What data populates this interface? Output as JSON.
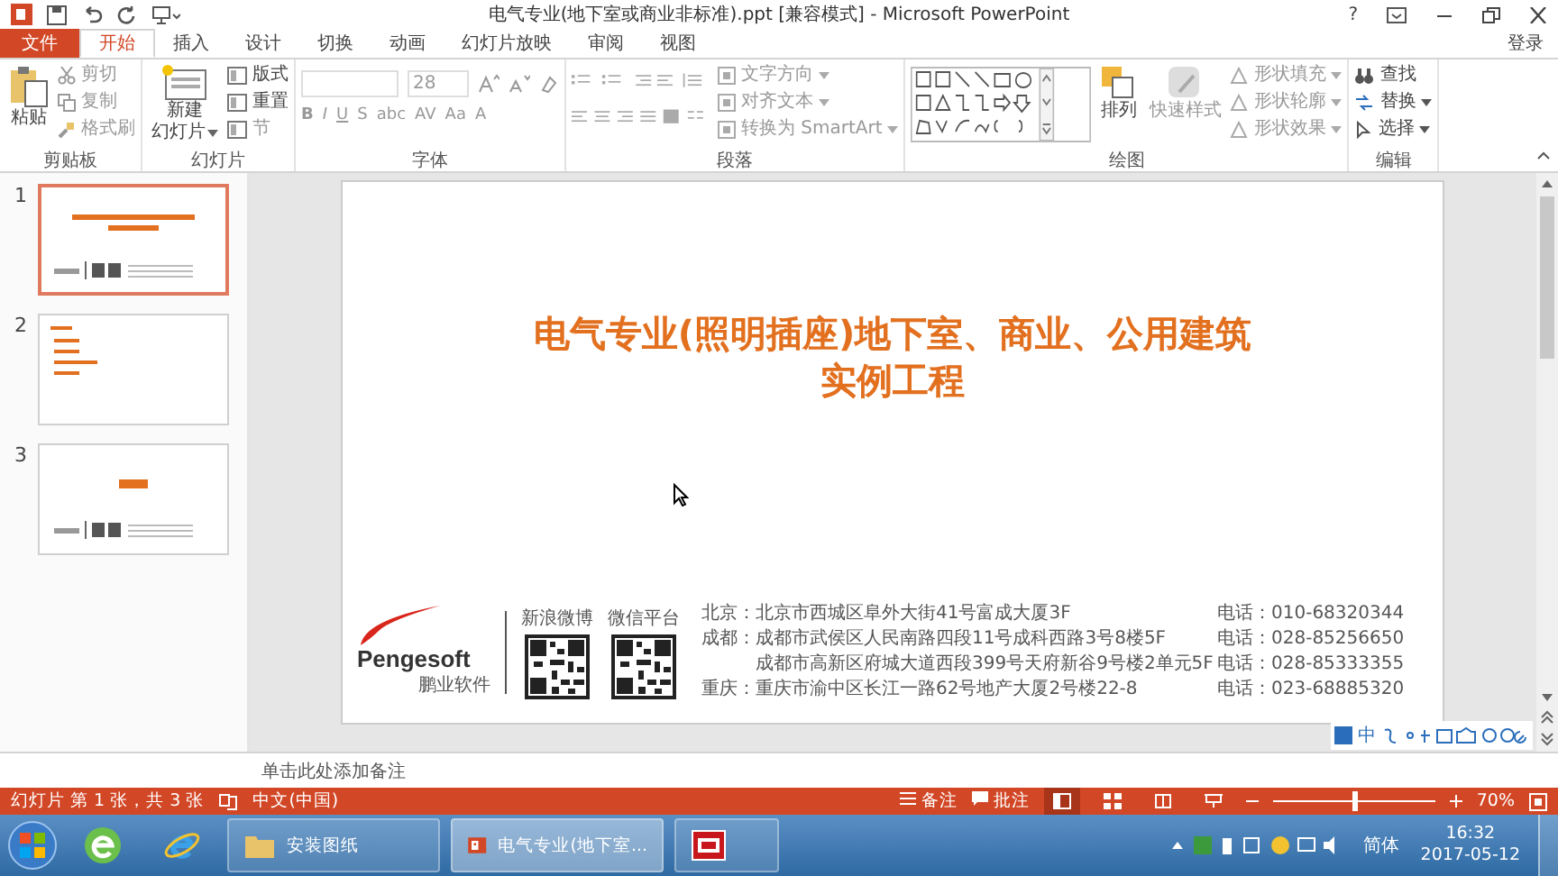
{
  "window": {
    "title": "电气专业(地下室或商业非标准).ppt [兼容模式] - Microsoft PowerPoint",
    "help": "?",
    "sign_in": "登录"
  },
  "ribbon_tabs": [
    {
      "label": "文件",
      "kind": "file",
      "selected": false
    },
    {
      "label": "开始",
      "kind": "tab",
      "selected": true
    },
    {
      "label": "插入",
      "kind": "tab",
      "selected": false
    },
    {
      "label": "设计",
      "kind": "tab",
      "selected": false
    },
    {
      "label": "切换",
      "kind": "tab",
      "selected": false
    },
    {
      "label": "动画",
      "kind": "tab",
      "selected": false
    },
    {
      "label": "幻灯片放映",
      "kind": "tab",
      "selected": false
    },
    {
      "label": "审阅",
      "kind": "tab",
      "selected": false
    },
    {
      "label": "视图",
      "kind": "tab",
      "selected": false
    }
  ],
  "clipboard": {
    "label": "剪贴板",
    "paste": "粘贴",
    "items": [
      "剪切",
      "复制",
      "格式刷"
    ]
  },
  "slides_group": {
    "label": "幻灯片",
    "new_slide": [
      "新建",
      "幻灯片"
    ],
    "items": [
      "版式",
      "重置",
      "节"
    ]
  },
  "font": {
    "label": "字体",
    "size": "28",
    "buttons": [
      "B",
      "I",
      "U",
      "S",
      "abc",
      "AV",
      "Aa",
      "A"
    ]
  },
  "paragraph": {
    "label": "段落",
    "items": [
      "文字方向",
      "对齐文本",
      "转换为 SmartArt"
    ]
  },
  "drawing": {
    "label": "绘图",
    "arrange": "排列",
    "quick_styles": "快速样式",
    "items": [
      "形状填充",
      "形状轮廓",
      "形状效果"
    ]
  },
  "editing": {
    "label": "编辑",
    "items": [
      "查找",
      "替换",
      "选择"
    ]
  },
  "thumbnails": [
    {
      "number": "1",
      "kind": "title",
      "selected": true
    },
    {
      "number": "2",
      "kind": "list",
      "selected": false
    },
    {
      "number": "3",
      "kind": "closing",
      "selected": false
    }
  ],
  "slide": {
    "title_lines": [
      "电气专业(照明插座)地下室、商业、公用建筑",
      "实例工程"
    ],
    "logo": {
      "name": "Pengesoft",
      "chinese": "鹏业软件"
    },
    "qr_codes": [
      {
        "label": "新浪微博"
      },
      {
        "label": "微信平台"
      }
    ],
    "offices": [
      {
        "city": "北京：",
        "address": "北京市西城区阜外大街41号富成大厦3F",
        "phone": "电话：010-68320344"
      },
      {
        "city": "成都：",
        "address": "成都市武侯区人民南路四段11号成科西路3号8楼5F",
        "phone": "电话：028-85256650"
      },
      {
        "address": "成都市高新区府城大道西段399号天府新谷9号楼2单元5F",
        "phone": "电话：028-85333355"
      },
      {
        "city": "重庆：",
        "address": "重庆市渝中区长江一路62号地产大厦2号楼22-8",
        "phone": "电话：023-68885320"
      }
    ]
  },
  "ime_bar": {
    "label": "中"
  },
  "notes": {
    "placeholder": "单击此处添加备注"
  },
  "status_bar": {
    "slide_info": "幻灯片 第 1 张，共 3 张",
    "language": "中文(中国)",
    "notes": "备注",
    "comments": "批注",
    "views": [
      {
        "kind": "normal",
        "selected": true
      },
      {
        "kind": "sorter",
        "selected": false
      },
      {
        "kind": "reading",
        "selected": false
      },
      {
        "kind": "show",
        "selected": false
      }
    ],
    "zoom": {
      "level": 0.5,
      "reading": "70%"
    }
  },
  "taskbar": {
    "tasks": [
      {
        "kind": "folder",
        "label": "安装图纸",
        "selected": false
      },
      {
        "kind": "powerpoint",
        "label": "电气专业(地下室...",
        "selected": true
      },
      {
        "kind": "app",
        "selected": false
      }
    ],
    "ime": "简体",
    "time": "16:32",
    "date": "2017-05-12"
  }
}
